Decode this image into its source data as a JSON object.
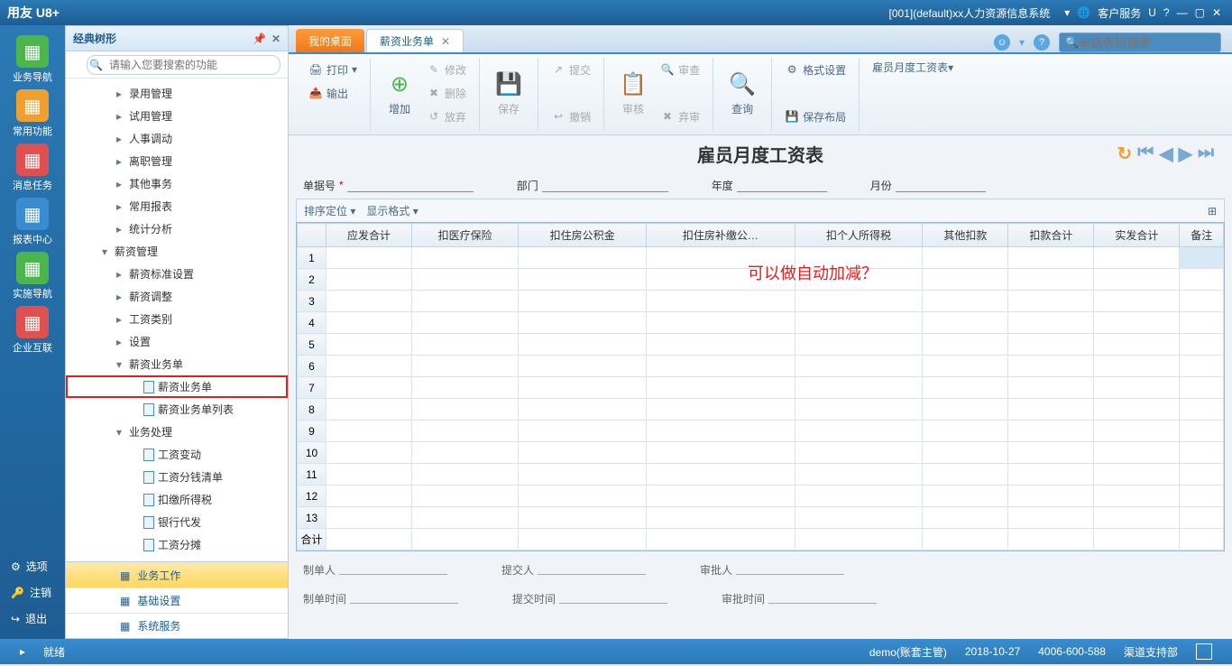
{
  "titlebar": {
    "logo": "用友 U8+",
    "sysinfo": "[001](default)xx人力资源信息系统",
    "svc": "客户服务",
    "u": "U"
  },
  "leftnav": {
    "items": [
      {
        "label": "业务导航",
        "color": "#4cb64c"
      },
      {
        "label": "常用功能",
        "color": "#f0a030"
      },
      {
        "label": "消息任务",
        "color": "#e05050"
      },
      {
        "label": "报表中心",
        "color": "#3a8cd0"
      },
      {
        "label": "实施导航",
        "color": "#4cb64c"
      },
      {
        "label": "企业互联",
        "color": "#e05050"
      }
    ],
    "footer": [
      {
        "icon": "⚙",
        "label": "选项"
      },
      {
        "icon": "🔑",
        "label": "注销"
      },
      {
        "icon": "↪",
        "label": "退出"
      }
    ]
  },
  "tree": {
    "title": "经典树形",
    "search_placeholder": "请输入您要搜索的功能",
    "items": [
      {
        "level": 3,
        "caret": "▸",
        "label": "录用管理"
      },
      {
        "level": 3,
        "caret": "▸",
        "label": "试用管理"
      },
      {
        "level": 3,
        "caret": "▸",
        "label": "人事调动"
      },
      {
        "level": 3,
        "caret": "▸",
        "label": "离职管理"
      },
      {
        "level": 3,
        "caret": "▸",
        "label": "其他事务"
      },
      {
        "level": 3,
        "caret": "▸",
        "label": "常用报表"
      },
      {
        "level": 3,
        "caret": "▸",
        "label": "统计分析"
      },
      {
        "level": 2,
        "caret": "▾",
        "label": "薪资管理"
      },
      {
        "level": 3,
        "caret": "▸",
        "label": "薪资标准设置"
      },
      {
        "level": 3,
        "caret": "▸",
        "label": "薪资调整"
      },
      {
        "level": 3,
        "caret": "▸",
        "label": "工资类别"
      },
      {
        "level": 3,
        "caret": "▸",
        "label": "设置"
      },
      {
        "level": 3,
        "caret": "▾",
        "label": "薪资业务单"
      },
      {
        "level": 4,
        "caret": "",
        "label": "薪资业务单",
        "doc": true,
        "highlighted": true
      },
      {
        "level": 4,
        "caret": "",
        "label": "薪资业务单列表",
        "doc": true
      },
      {
        "level": 3,
        "caret": "▾",
        "label": "业务处理"
      },
      {
        "level": 4,
        "caret": "",
        "label": "工资变动",
        "doc": true
      },
      {
        "level": 4,
        "caret": "",
        "label": "工资分钱清单",
        "doc": true
      },
      {
        "level": 4,
        "caret": "",
        "label": "扣缴所得税",
        "doc": true
      },
      {
        "level": 4,
        "caret": "",
        "label": "银行代发",
        "doc": true
      },
      {
        "level": 4,
        "caret": "",
        "label": "工资分摊",
        "doc": true
      }
    ],
    "bottom": [
      {
        "label": "业务工作",
        "active": true
      },
      {
        "label": "基础设置"
      },
      {
        "label": "系统服务"
      }
    ]
  },
  "tabs": {
    "tab1": "我的桌面",
    "tab2": "薪资业务单",
    "search_placeholder": "单据条码搜索"
  },
  "toolbar": {
    "print": "打印",
    "output": "输出",
    "add": "增加",
    "modify": "修改",
    "delete": "删除",
    "discard": "放弃",
    "save": "保存",
    "submit": "提交",
    "revoke": "撤销",
    "audit": "审核",
    "review": "审查",
    "abandon": "弃审",
    "query": "查询",
    "format": "格式设置",
    "savelayout": "保存布局",
    "report": "雇员月度工资表"
  },
  "doc": {
    "title": "雇员月度工资表",
    "fields": {
      "no": "单据号",
      "dept": "部门",
      "year": "年度",
      "month": "月份"
    }
  },
  "gridtools": {
    "sort": "排序定位",
    "display": "显示格式"
  },
  "columns": [
    "",
    "应发合计",
    "扣医疗保险",
    "扣住房公积金",
    "扣住房补缴公…",
    "扣个人所得税",
    "其他扣款",
    "扣款合计",
    "实发合计",
    "备注"
  ],
  "total_label": "合计",
  "annotation": "可以做自动加减？",
  "footer_form": {
    "maker": "制单人",
    "submitter": "提交人",
    "approver": "审批人",
    "maketime": "制单时间",
    "submittime": "提交时间",
    "approvetime": "审批时间"
  },
  "status": {
    "ready": "就绪",
    "user": "demo(账套主管)",
    "date": "2018-10-27",
    "phone": "4006-600-588",
    "dept": "渠道支持部"
  }
}
